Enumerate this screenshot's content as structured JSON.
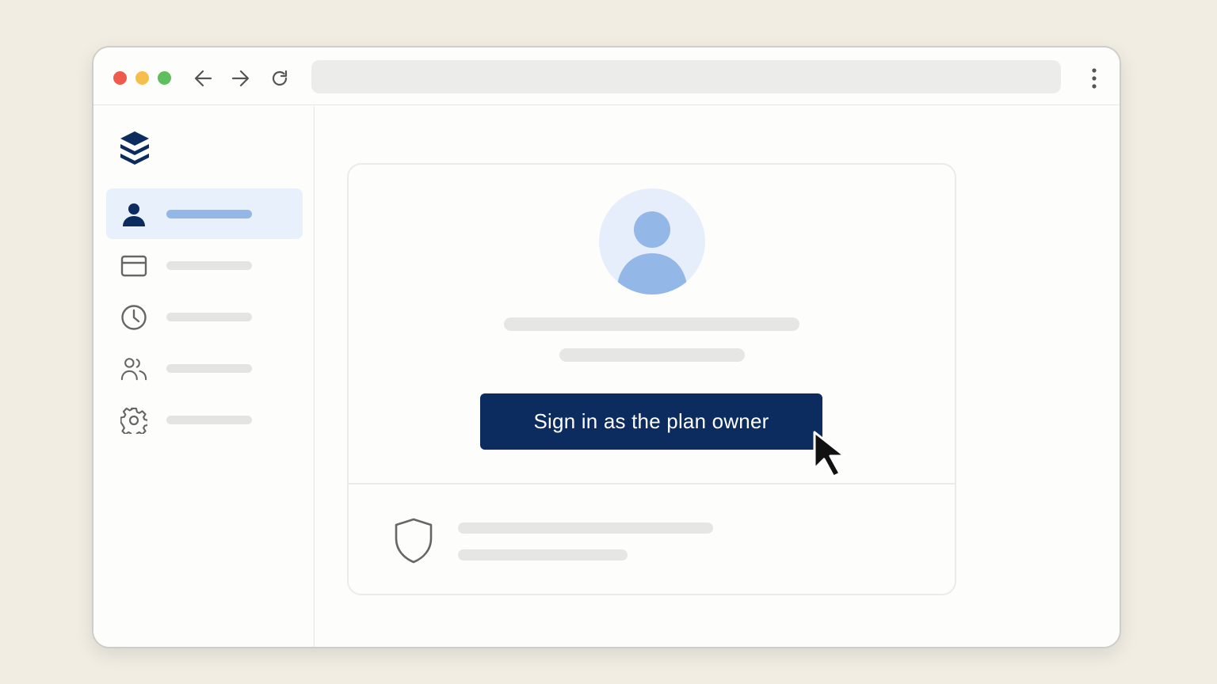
{
  "browser": {
    "address_value": "",
    "icons": {
      "back": "arrow-left-icon",
      "forward": "arrow-right-icon",
      "reload": "reload-icon",
      "menu": "kebab-menu-icon"
    },
    "traffic_lights": [
      "#ee5a4c",
      "#f6be4a",
      "#5fbe5e"
    ]
  },
  "sidebar": {
    "logo": "stacked-layers-logo",
    "items": [
      {
        "icon": "user-icon",
        "active": true
      },
      {
        "icon": "credit-card-icon",
        "active": false
      },
      {
        "icon": "clock-icon",
        "active": false
      },
      {
        "icon": "users-icon",
        "active": false
      },
      {
        "icon": "gear-icon",
        "active": false
      }
    ]
  },
  "main": {
    "avatar": "user-avatar-icon",
    "signin_button": {
      "label": "Sign in as the plan owner"
    },
    "security_icon": "shield-icon"
  },
  "colors": {
    "primary": "#0c2b5e",
    "accent": "#93b7e6",
    "active_bg": "#e8f0fb",
    "background": "#f1ede3"
  }
}
